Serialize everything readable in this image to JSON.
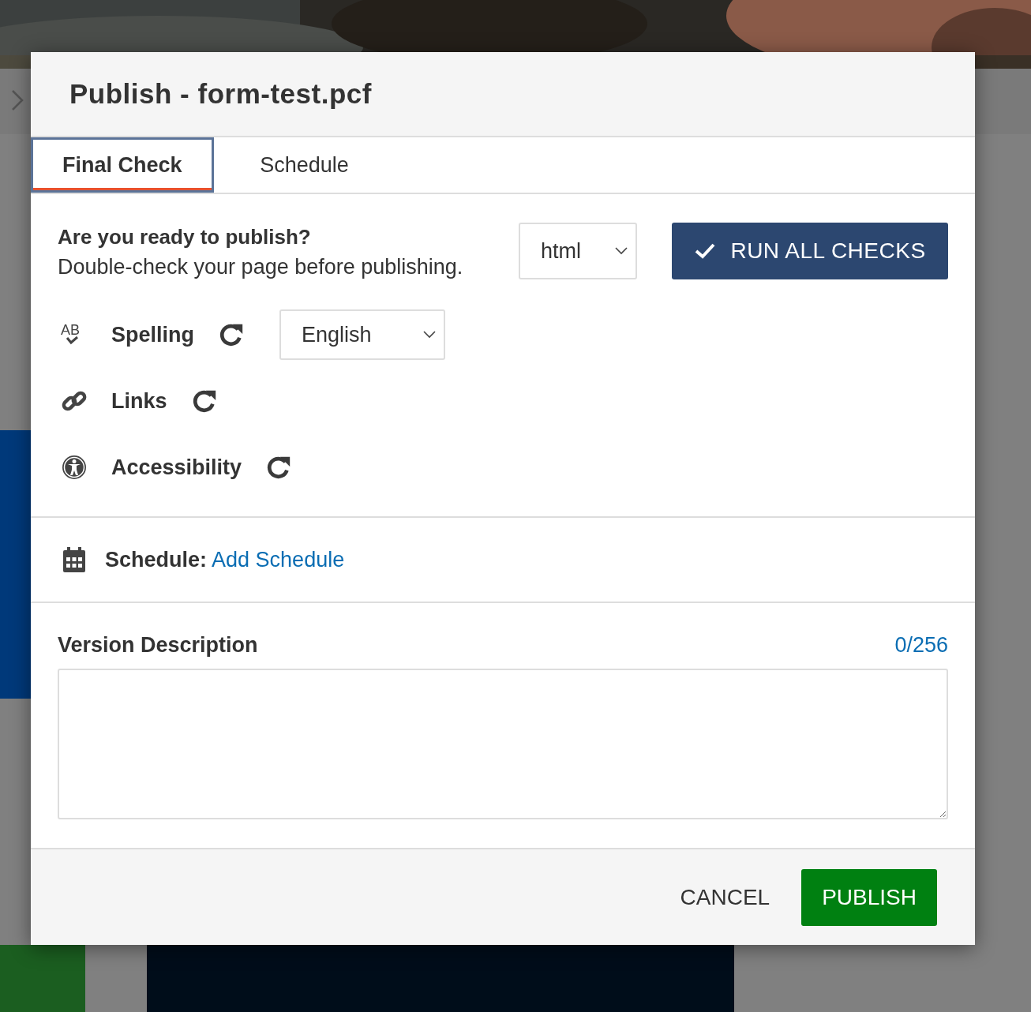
{
  "dialog": {
    "title": "Publish - form-test.pcf",
    "tabs": [
      {
        "label": "Final Check",
        "selected": true
      },
      {
        "label": "Schedule",
        "selected": false
      }
    ],
    "intro": {
      "heading": "Are you ready to publish?",
      "text": "Double-check your page before publishing."
    },
    "output_select": {
      "value": "html"
    },
    "run_button": {
      "label": "RUN ALL CHECKS"
    },
    "checks": [
      {
        "kind": "spelling",
        "label": "Spelling",
        "icon_text": "AB",
        "language": "English"
      },
      {
        "kind": "links",
        "label": "Links"
      },
      {
        "kind": "accessibility",
        "label": "Accessibility"
      }
    ],
    "schedule": {
      "label": "Schedule:",
      "link": "Add Schedule"
    },
    "version": {
      "label": "Version Description",
      "counter": "0/256"
    },
    "buttons": [
      {
        "kind": "cancel",
        "label": "CANCEL"
      },
      {
        "kind": "primary",
        "label": "PUBLISH"
      }
    ]
  }
}
